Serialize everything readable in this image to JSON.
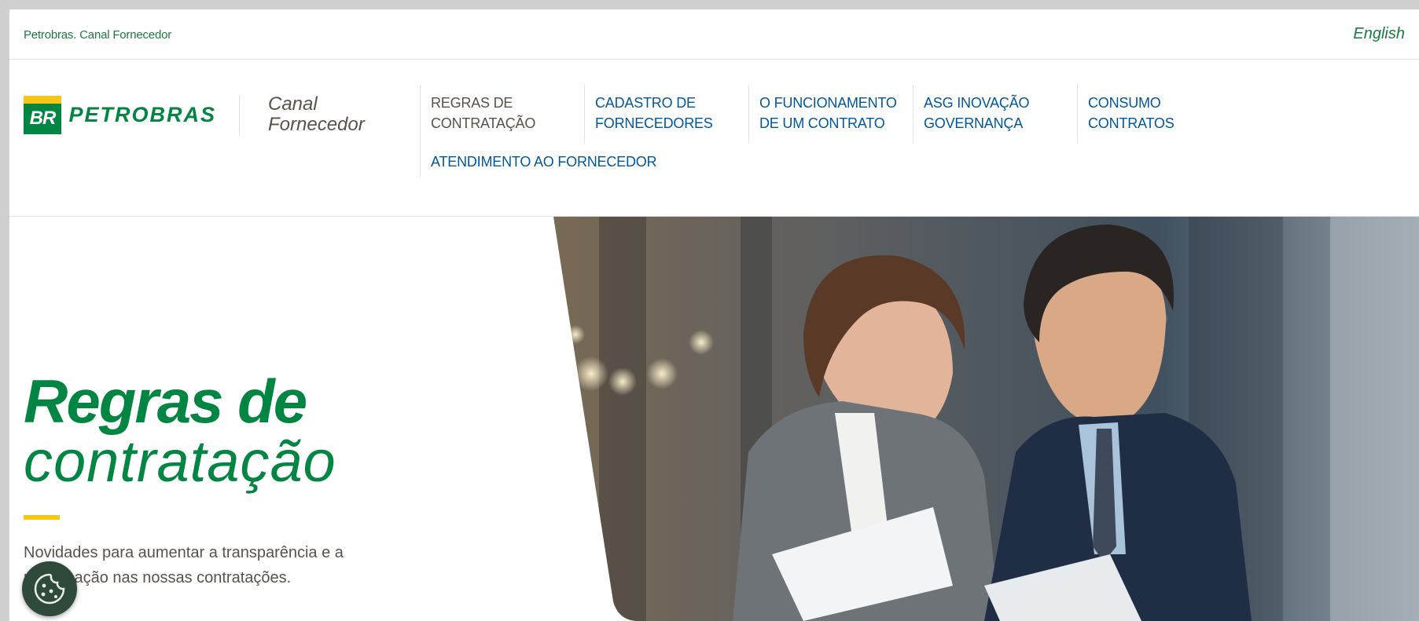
{
  "topbar": {
    "site_link": "Petrobras. Canal Fornecedor",
    "language_link": "English"
  },
  "header": {
    "logo_badge": "BR",
    "logo_wordmark": "PETROBRAS",
    "section_title_line1": "Canal",
    "section_title_line2": "Fornecedor",
    "nav": [
      {
        "line1": "REGRAS DE",
        "line2": "CONTRATAÇÃO",
        "active": true
      },
      {
        "line1": "CADASTRO DE",
        "line2": "FORNECEDORES"
      },
      {
        "line1": "O FUNCIONAMENTO",
        "line2": "DE UM CONTRATO"
      },
      {
        "line1": "ASG INOVAÇÃO",
        "line2": "GOVERNANÇA"
      },
      {
        "line1": "CONSUMO",
        "line2": "CONTRATOS"
      },
      {
        "line1": "ATENDIMENTO AO FORNECEDOR",
        "line2": ""
      }
    ]
  },
  "hero": {
    "title_bold": "Regras de",
    "title_light": "contratação",
    "description": "Novidades para aumentar a transparência e a participação nas nossas contratações."
  },
  "colors": {
    "brand_green": "#008542",
    "brand_yellow": "#f5c518",
    "nav_blue": "#00579b",
    "text_brown": "#5b5148",
    "cookie_bg": "#2f4a3b"
  },
  "icons": {
    "cookie": "cookie-icon"
  }
}
